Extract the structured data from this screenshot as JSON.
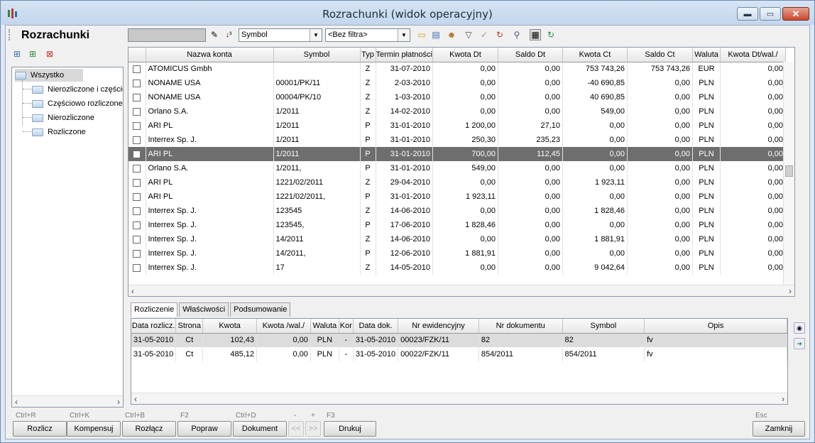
{
  "window": {
    "title": "Rozrachunki (widok operacyjny)"
  },
  "toolbar": {
    "page_title": "Rozrachunki",
    "sort_field": "Symbol",
    "filter": "<Bez filtra>"
  },
  "tree": {
    "root": "Wszystko",
    "items": [
      "Nierozliczone i częściowo rozliczone",
      "Częściowo rozliczone",
      "Nierozliczone",
      "Rozliczone"
    ]
  },
  "grid": {
    "columns": [
      "",
      "Nazwa konta",
      "Symbol",
      "Typ",
      "Termin płatności",
      "Kwota Dt",
      "Saldo Dt",
      "Kwota Ct",
      "Saldo Ct",
      "Waluta",
      "Kwota Dt/wal./"
    ],
    "rows": [
      [
        "ATOMICUS Gmbh",
        "",
        "Z",
        "31-07-2010",
        "0,00",
        "0,00",
        "753 743,26",
        "753 743,26",
        "EUR",
        "0,00"
      ],
      [
        "NONAME USA",
        "00001/PK/11",
        "Z",
        "2-03-2010",
        "0,00",
        "0,00",
        "-40 690,85",
        "0,00",
        "PLN",
        "0,00"
      ],
      [
        "NONAME USA",
        "00004/PK/10",
        "Z",
        "1-03-2010",
        "0,00",
        "0,00",
        "40 690,85",
        "0,00",
        "PLN",
        "0,00"
      ],
      [
        "Orlano S.A.",
        "1/2011",
        "Z",
        "14-02-2010",
        "0,00",
        "0,00",
        "549,00",
        "0,00",
        "PLN",
        "0,00"
      ],
      [
        "ARI PL",
        "1/2011",
        "P",
        "31-01-2010",
        "1 200,00",
        "27,10",
        "0,00",
        "0,00",
        "PLN",
        "0,00"
      ],
      [
        "Interrex Sp. J.",
        "1/2011",
        "P",
        "31-01-2010",
        "250,30",
        "235,23",
        "0,00",
        "0,00",
        "PLN",
        "0,00"
      ],
      [
        "ARI PL",
        "1/2011",
        "P",
        "31-01-2010",
        "700,00",
        "112,45",
        "0,00",
        "0,00",
        "PLN",
        "0,00"
      ],
      [
        "Orlano S.A.",
        "1/2011,",
        "P",
        "31-01-2010",
        "549,00",
        "0,00",
        "0,00",
        "0,00",
        "PLN",
        "0,00"
      ],
      [
        "ARI PL",
        "1221/02/2011",
        "Z",
        "29-04-2010",
        "0,00",
        "0,00",
        "1 923,11",
        "0,00",
        "PLN",
        "0,00"
      ],
      [
        "ARI PL",
        "1221/02/2011,",
        "P",
        "31-01-2010",
        "1 923,11",
        "0,00",
        "0,00",
        "0,00",
        "PLN",
        "0,00"
      ],
      [
        "Interrex Sp. J.",
        "123545",
        "Z",
        "14-06-2010",
        "0,00",
        "0,00",
        "1 828,46",
        "0,00",
        "PLN",
        "0,00"
      ],
      [
        "Interrex Sp. J.",
        "123545,",
        "P",
        "17-06-2010",
        "1 828,46",
        "0,00",
        "0,00",
        "0,00",
        "PLN",
        "0,00"
      ],
      [
        "Interrex Sp. J.",
        "14/2011",
        "Z",
        "14-06-2010",
        "0,00",
        "0,00",
        "1 881,91",
        "0,00",
        "PLN",
        "0,00"
      ],
      [
        "Interrex Sp. J.",
        "14/2011,",
        "P",
        "12-06-2010",
        "1 881,91",
        "0,00",
        "0,00",
        "0,00",
        "PLN",
        "0,00"
      ],
      [
        "Interrex Sp. J.",
        "17",
        "Z",
        "14-05-2010",
        "0,00",
        "0,00",
        "9 042,64",
        "0,00",
        "PLN",
        "0,00"
      ]
    ],
    "selected_row": 6
  },
  "tabs": [
    "Rozliczenie",
    "Właściwości",
    "Podsumowanie"
  ],
  "settlements": {
    "columns": [
      "Data rozlicz.",
      "Strona",
      "Kwota",
      "Kwota /wal./",
      "Waluta",
      "Kor",
      "Data dok.",
      "Nr ewidencyjny",
      "Nr dokumentu",
      "Symbol",
      "Opis"
    ],
    "rows": [
      [
        "31-05-2010",
        "Ct",
        "102,43",
        "0,00",
        "PLN",
        "-",
        "31-05-2010",
        "00023/FZK/11",
        "82",
        "82",
        "fv"
      ],
      [
        "31-05-2010",
        "Ct",
        "485,12",
        "0,00",
        "PLN",
        "-",
        "31-05-2010",
        "00022/FZK/11",
        "854/2011",
        "854/2011",
        "fv"
      ]
    ]
  },
  "buttons": [
    {
      "shortcut": "Ctrl+R",
      "label": "Rozlicz"
    },
    {
      "shortcut": "Ctrl+K",
      "label": "Kompensuj"
    },
    {
      "shortcut": "Ctrl+B",
      "label": "Rozłącz"
    },
    {
      "shortcut": "F2",
      "label": "Popraw"
    },
    {
      "shortcut": "Ctrl+D",
      "label": "Dokument"
    },
    {
      "shortcut": "-",
      "label": "<<"
    },
    {
      "shortcut": "+",
      "label": ">>"
    },
    {
      "shortcut": "F3",
      "label": "Drukuj"
    },
    {
      "shortcut": "Esc",
      "label": "Zamknij"
    }
  ]
}
